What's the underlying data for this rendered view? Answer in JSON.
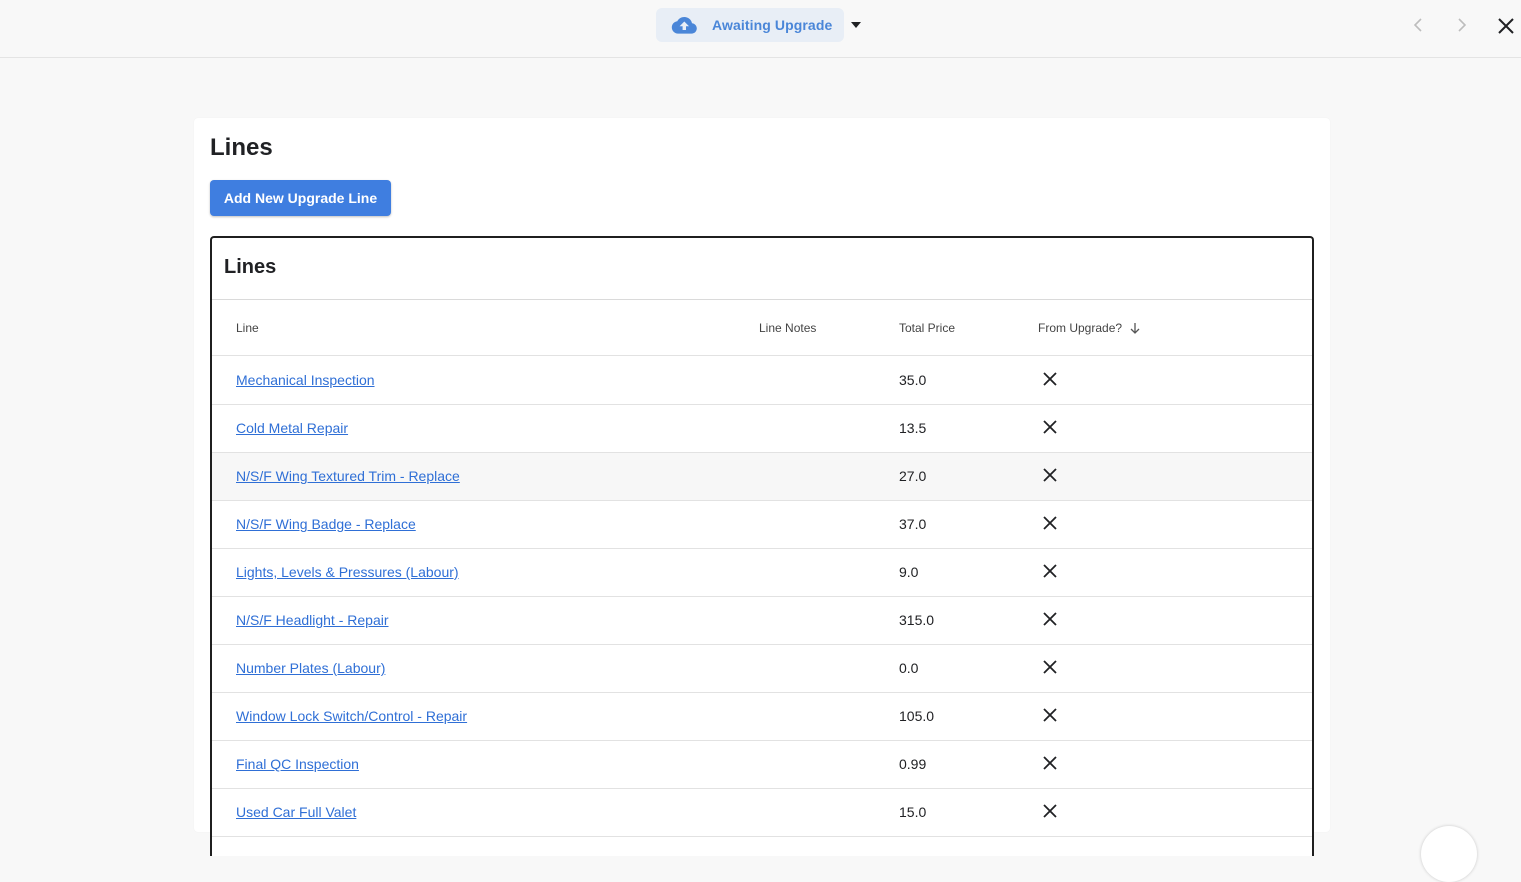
{
  "topbar": {
    "status_label": "Awaiting Upgrade",
    "status_icon": "cloud-upload-icon",
    "accent_color": "#4a86d8"
  },
  "card": {
    "title": "Lines",
    "add_button_label": "Add New Upgrade Line",
    "button_color": "#3f7ee0"
  },
  "table": {
    "title": "Lines",
    "columns": {
      "line": "Line",
      "notes": "Line Notes",
      "price": "Total Price",
      "upgrade": "From Upgrade?"
    },
    "sort": "descending",
    "rows": [
      {
        "line": "Mechanical Inspection",
        "notes": "",
        "price": "35.0",
        "from_upgrade": false
      },
      {
        "line": "Cold Metal Repair",
        "notes": "",
        "price": "13.5",
        "from_upgrade": false
      },
      {
        "line": "N/S/F Wing Textured Trim - Replace",
        "notes": "",
        "price": "27.0",
        "from_upgrade": false
      },
      {
        "line": "N/S/F Wing Badge - Replace",
        "notes": "",
        "price": "37.0",
        "from_upgrade": false
      },
      {
        "line": "Lights, Levels & Pressures (Labour)",
        "notes": "",
        "price": "9.0",
        "from_upgrade": false
      },
      {
        "line": "N/S/F Headlight - Repair",
        "notes": "",
        "price": "315.0",
        "from_upgrade": false
      },
      {
        "line": "Number Plates (Labour)",
        "notes": "",
        "price": "0.0",
        "from_upgrade": false
      },
      {
        "line": "Window Lock Switch/Control - Repair",
        "notes": "",
        "price": "105.0",
        "from_upgrade": false
      },
      {
        "line": "Final QC Inspection",
        "notes": "",
        "price": "0.99",
        "from_upgrade": false
      },
      {
        "line": "Used Car Full Valet",
        "notes": "",
        "price": "15.0",
        "from_upgrade": false
      }
    ]
  }
}
